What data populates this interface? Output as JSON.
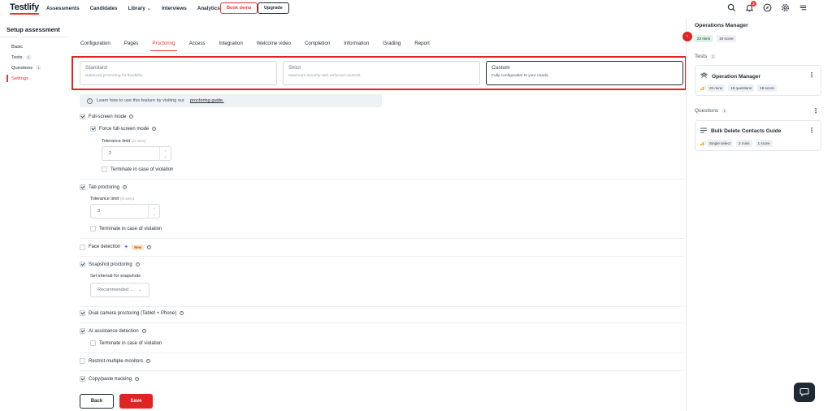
{
  "brand": {
    "name": "Testlify",
    "accent": "#e53935"
  },
  "nav": {
    "links": [
      "Assessments",
      "Candidates",
      "Library",
      "Interviews",
      "Analytics"
    ],
    "book_demo": "Book demo",
    "upgrade": "Upgrade",
    "notification_count": "2",
    "icons": [
      "search-icon",
      "bell-icon",
      "compass-icon",
      "gear-icon",
      "menu-icon"
    ]
  },
  "sidebar": {
    "title": "Setup assessment",
    "items": [
      {
        "label": "Basic",
        "count": ""
      },
      {
        "label": "Tests",
        "count": "1"
      },
      {
        "label": "Questions",
        "count": "1"
      },
      {
        "label": "Settings",
        "count": "",
        "active": true
      }
    ]
  },
  "tabs": [
    "Configuration",
    "Pages",
    "Proctoring",
    "Access",
    "Integration",
    "Welcome video",
    "Completion",
    "Information",
    "Grading",
    "Report"
  ],
  "active_tab": "Proctoring",
  "presets": [
    {
      "title": "Standard",
      "desc": "Balanced proctoring for flexibility."
    },
    {
      "title": "Strict",
      "desc": "Maximum security with enforced controls."
    },
    {
      "title": "Custom",
      "desc": "Fully configurable to your needs.",
      "selected": true
    }
  ],
  "info_banner": {
    "text": "Learn how to use this feature by visiting our",
    "link": "proctoring guide."
  },
  "settings": {
    "full_screen": {
      "label": "Full-screen mode",
      "checked": true
    },
    "force_full_screen": {
      "label": "Force full-screen mode",
      "checked": true
    },
    "tolerance_label": "Tolerance limit",
    "tolerance_unit": "(in secs)",
    "full_screen_tolerance": "2",
    "terminate_label": "Terminate in case of violation",
    "tab_proctoring": {
      "label": "Tab proctoring",
      "checked": true
    },
    "tab_tolerance": "3",
    "face_detection": {
      "label": "Face detection",
      "badge": "New",
      "checked": false
    },
    "snapshot": {
      "label": "Snapshot proctoring",
      "checked": true
    },
    "snapshot_interval_label": "Set interval for snapshots",
    "snapshot_interval_value": "Recommended ...",
    "dual_camera": {
      "label": "Dual camera proctoring (Tablet + Phone)",
      "checked": true
    },
    "ai_assistance": {
      "label": "AI assistance detection",
      "checked": true
    },
    "restrict_monitors": {
      "label": "Restrict multiple monitors",
      "checked": false
    },
    "copy_paste": {
      "label": "Copy/paste tracking",
      "checked": true
    }
  },
  "actions": {
    "back": "Back",
    "save": "Save"
  },
  "right_panel": {
    "title": "Operations Manager",
    "chips": [
      "22 mins",
      "19 score"
    ],
    "tests_label": "Tests",
    "tests_count": "1",
    "test_card": {
      "title": "Operation Manager",
      "chips": [
        "20 mins",
        "18 questions",
        "18 score"
      ]
    },
    "questions_label": "Questions",
    "questions_count": "1",
    "question_card": {
      "title": "Bulk Delete Contacts Guide",
      "chips": [
        "Single select",
        "2 mins",
        "1 score"
      ]
    }
  }
}
